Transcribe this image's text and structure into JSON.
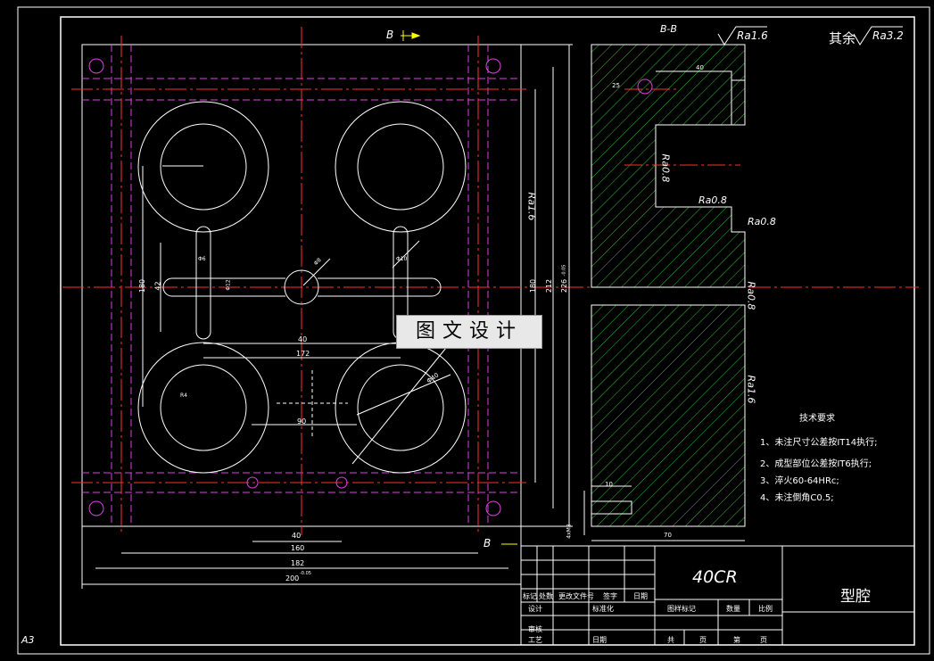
{
  "drawing": {
    "sheet_size": "A3",
    "material": "40CR",
    "part_name": "型腔",
    "section_label": "B-B",
    "cut_marker": "B",
    "roughness_general": "其余",
    "roughness_values": {
      "ra32": "Ra3.2",
      "ra16": "Ra1.6",
      "ra08": "Ra0.8"
    },
    "watermark": "图文设计",
    "tech_req": {
      "title": "技术要求",
      "items": [
        "1、未注尺寸公差按IT14执行;",
        "2、成型部位公差按IT6执行;",
        "3、淬火60-64HRc;",
        "4、未注倒角C0.5;"
      ]
    },
    "dimensions": {
      "bottom": [
        "40",
        "160",
        "182",
        "200"
      ],
      "bottom_tol": "-0.05",
      "right": [
        "180",
        "212",
        "226"
      ],
      "right_tol": "-0.05",
      "left": [
        "180",
        "42"
      ],
      "inner": [
        "40",
        "172",
        "90",
        "Φ8",
        "Φ6",
        "Φ12",
        "Φ10",
        "Φ40",
        "R4"
      ],
      "side": [
        "40",
        "25",
        "10",
        "70",
        "4xM8"
      ]
    },
    "title_block": {
      "header": [
        "标记",
        "处数",
        "更改文件号",
        "签字",
        "日期"
      ],
      "rows": [
        "设计",
        "标准化",
        "审核",
        "工艺",
        "日期"
      ],
      "right": [
        "图样标记",
        "数量",
        "比例",
        "共",
        "页",
        "第",
        "页"
      ]
    }
  }
}
